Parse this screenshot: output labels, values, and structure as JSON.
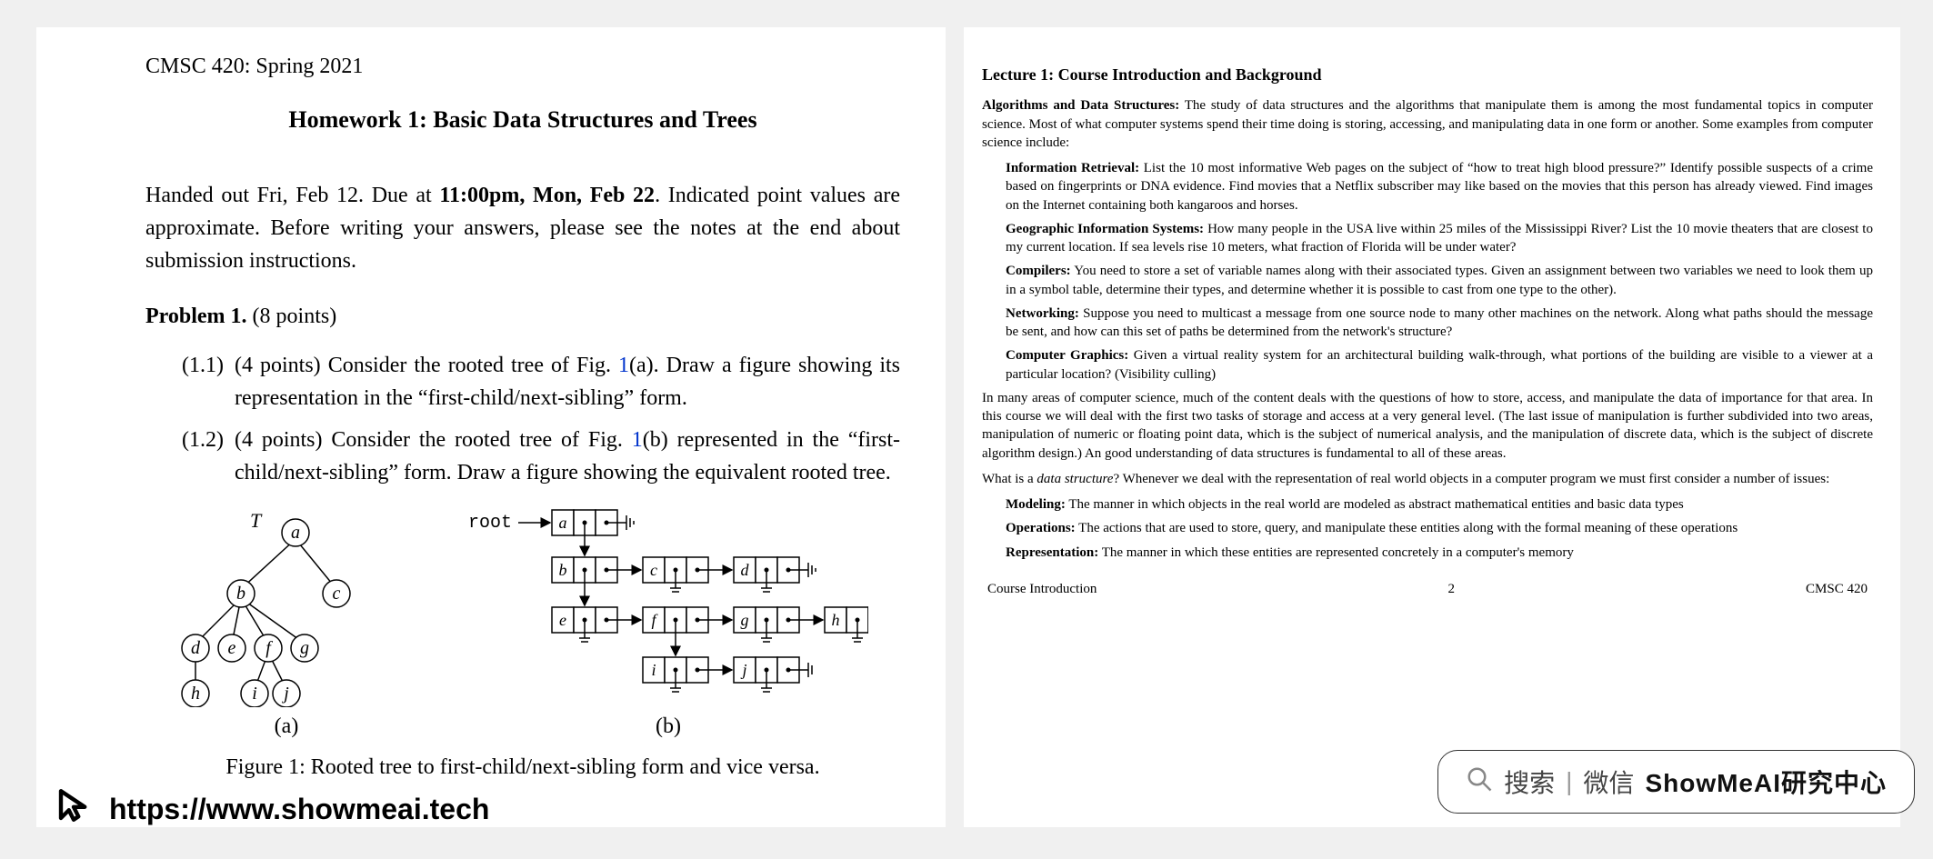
{
  "left": {
    "course": "CMSC 420: Spring 2021",
    "title": "Homework 1: Basic Data Structures and Trees",
    "intro_pre": "Handed out Fri, Feb 12. Due at ",
    "intro_bold": "11:00pm, Mon, Feb 22",
    "intro_post": ". Indicated point values are approximate. Before writing your answers, please see the notes at the end about submission instructions.",
    "problem_label": "Problem 1.",
    "problem_points": "(8 points)",
    "sub": [
      {
        "num": "(1.1)",
        "pts": "(4 points)",
        "t1": "Consider the rooted tree of Fig. ",
        "ref": "1",
        "t2": "(a). Draw a figure showing its representation in the “first-child/next-sibling” form."
      },
      {
        "num": "(1.2)",
        "pts": "(4 points)",
        "t1": "Consider the rooted tree of Fig. ",
        "ref": "1",
        "t2": "(b) represented in the “first-child/next-sibling” form. Draw a figure showing the equivalent rooted tree."
      }
    ],
    "tree_label": "T",
    "tree_nodes": [
      "a",
      "b",
      "c",
      "d",
      "e",
      "f",
      "g",
      "h",
      "i",
      "j"
    ],
    "root_label": "root",
    "fig_a": "(a)",
    "fig_b": "(b)",
    "fig_caption": "Figure 1: Rooted tree to first-child/next-sibling form and vice versa."
  },
  "right": {
    "lecture_title": "Lecture 1: Course Introduction and Background",
    "p1_lead": "Algorithms and Data Structures:",
    "p1_body": " The study of data structures and the algorithms that manipulate them is among the most fundamental topics in computer science. Most of what computer systems spend their time doing is storing, accessing, and manipulating data in one form or another. Some examples from computer science include:",
    "items": [
      {
        "lead": "Information Retrieval:",
        "body": " List the 10 most informative Web pages on the subject of “how to treat high blood pressure?” Identify possible suspects of a crime based on fingerprints or DNA evidence. Find movies that a Netflix subscriber may like based on the movies that this person has already viewed. Find images on the Internet containing both kangaroos and horses."
      },
      {
        "lead": "Geographic Information Systems:",
        "body": " How many people in the USA live within 25 miles of the Mississippi River? List the 10 movie theaters that are closest to my current location. If sea levels rise 10 meters, what fraction of Florida will be under water?"
      },
      {
        "lead": "Compilers:",
        "body": " You need to store a set of variable names along with their associated types. Given an assignment between two variables we need to look them up in a symbol table, determine their types, and determine whether it is possible to cast from one type to the other)."
      },
      {
        "lead": "Networking:",
        "body": " Suppose you need to multicast a message from one source node to many other machines on the network. Along what paths should the message be sent, and how can this set of paths be determined from the network's structure?"
      },
      {
        "lead": "Computer Graphics:",
        "body": " Given a virtual reality system for an architectural building walk-through, what portions of the building are visible to a viewer at a particular location? (Visibility culling)"
      }
    ],
    "p2": "In many areas of computer science, much of the content deals with the questions of how to store, access, and manipulate the data of importance for that area. In this course we will deal with the first two tasks of storage and access at a very general level. (The last issue of manipulation is further subdivided into two areas, manipulation of numeric or floating point data, which is the subject of numerical analysis, and the manipulation of discrete data, which is the subject of discrete algorithm design.) An good understanding of data structures is fundamental to all of these areas.",
    "p3_pre": "What is a ",
    "p3_em": "data structure",
    "p3_post": "? Whenever we deal with the representation of real world objects in a computer program we must first consider a number of issues:",
    "defs": [
      {
        "lead": "Modeling:",
        "body": " The manner in which objects in the real world are modeled as abstract mathematical entities and basic data types"
      },
      {
        "lead": "Operations:",
        "body": " The actions that are used to store, query, and manipulate these entities along with the formal meaning of these operations"
      },
      {
        "lead": "Representation:",
        "body": " The manner in which these entities are represented concretely in a computer's memory"
      }
    ],
    "footer": {
      "left": "Course Introduction",
      "mid": "2",
      "right": "CMSC 420"
    }
  },
  "overlay": {
    "search": "搜索",
    "wechat": "微信",
    "brand": "ShowMeAI研究中心",
    "url": "https://www.showmeai.tech"
  }
}
